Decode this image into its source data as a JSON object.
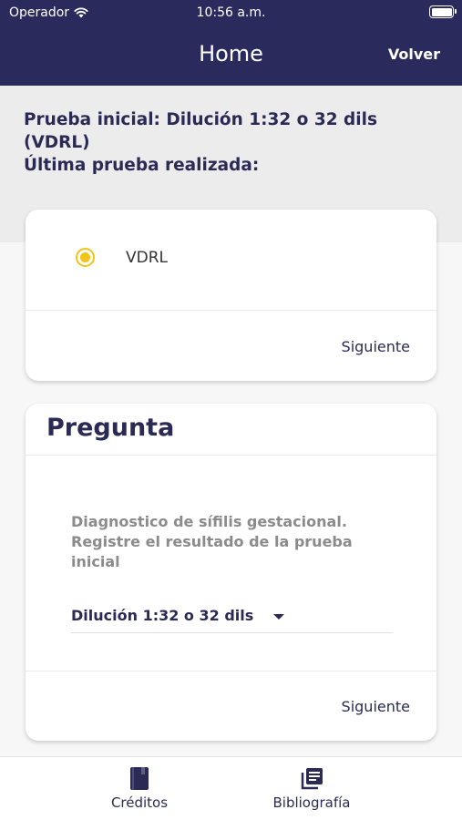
{
  "status_bar": {
    "carrier": "Operador",
    "time": "10:56 a.m."
  },
  "nav": {
    "title": "Home",
    "back_label": "Volver"
  },
  "info": {
    "line1": "Prueba inicial: Dilución 1:32 o 32 dils",
    "line2": "(VDRL)",
    "line3": "Última prueba realizada:"
  },
  "card1": {
    "option_label": "VDRL",
    "next_label": "Siguiente"
  },
  "card2": {
    "title": "Pregunta",
    "question": "Diagnostico de sífilis gestacional. Registre el resultado de la prueba inicial",
    "dropdown_value": "Dilución 1:32 o 32 dils",
    "next_label": "Siguiente"
  },
  "tabs": [
    {
      "label": "Créditos",
      "icon": "book-icon"
    },
    {
      "label": "Bibliografía",
      "icon": "library-icon"
    }
  ],
  "colors": {
    "primary": "#2b2a5c",
    "accent": "#f0c419",
    "panel": "#ececec"
  }
}
